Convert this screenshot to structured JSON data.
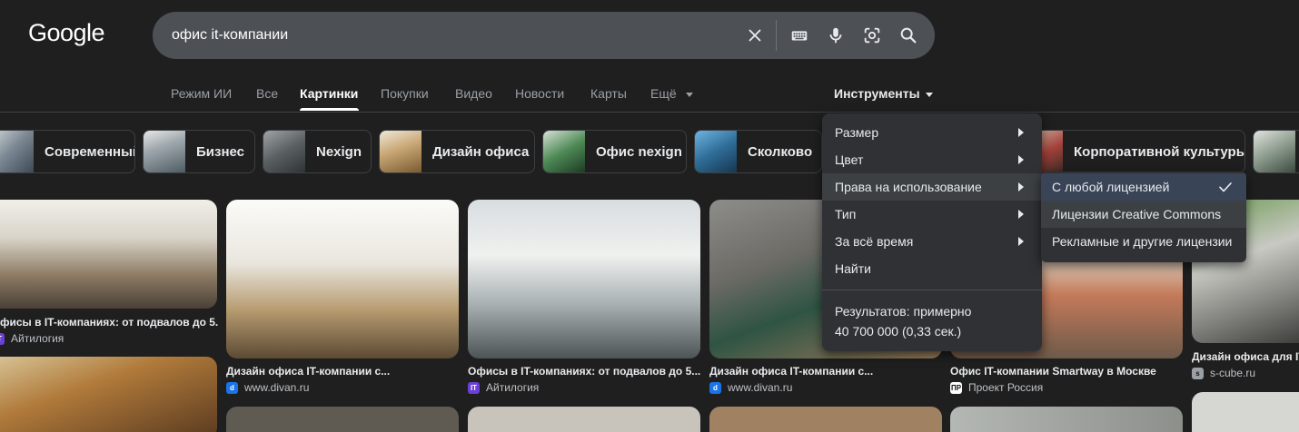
{
  "logo": "Google",
  "search": {
    "query": "офис it-компании"
  },
  "search_icons": [
    "clear-icon",
    "keyboard-icon",
    "microphone-icon",
    "lens-icon",
    "search-icon"
  ],
  "tabs": [
    "Режим ИИ",
    "Все",
    "Картинки",
    "Покупки",
    "Видео",
    "Новости",
    "Карты",
    "Ещё"
  ],
  "active_tab": "Картинки",
  "tools_label": "Инструменты",
  "chips": [
    "Современный",
    "Бизнес",
    "Nexign",
    "Дизайн офиса",
    "Офис nexign",
    "Сколково",
    "Корпоративной культуры"
  ],
  "menu": {
    "items": [
      "Размер",
      "Цвет",
      "Права на использование",
      "Тип",
      "За всё время",
      "Найти"
    ],
    "stats_line1": "Результатов: примерно",
    "stats_line2": "40 700 000 (0,33 сек.)"
  },
  "submenu": {
    "items": [
      "С любой лицензией",
      "Лицензии Creative Commons",
      "Рекламные и другие лицензии"
    ],
    "selected": "С любой лицензией"
  },
  "results": [
    {
      "title": "фисы в IT-компаниях: от подвалов до 5...",
      "source": "Айтилогия",
      "favicon": "IT"
    },
    {
      "title": "Дизайн офиса IT-компании с...",
      "source": "www.divan.ru",
      "favicon": "d"
    },
    {
      "title": "Офисы в IT-компаниях: от подвалов до 5...",
      "source": "Айтилогия",
      "favicon": "IT"
    },
    {
      "title": "Дизайн офиса IT-компании с...",
      "source": "www.divan.ru",
      "favicon": "d"
    },
    {
      "title": "Офис IT-компании Smartway в Москве",
      "source": "Проект Россия",
      "favicon": "ПР"
    },
    {
      "title": "Дизайн офиса для IT",
      "source": "s-cube.ru",
      "favicon": "s"
    }
  ],
  "colors": {
    "background": "#1f1f1f",
    "search_bar": "#4d5156",
    "menu": "#303134",
    "selected": "#394457",
    "muted_text": "#9aa0a6"
  }
}
